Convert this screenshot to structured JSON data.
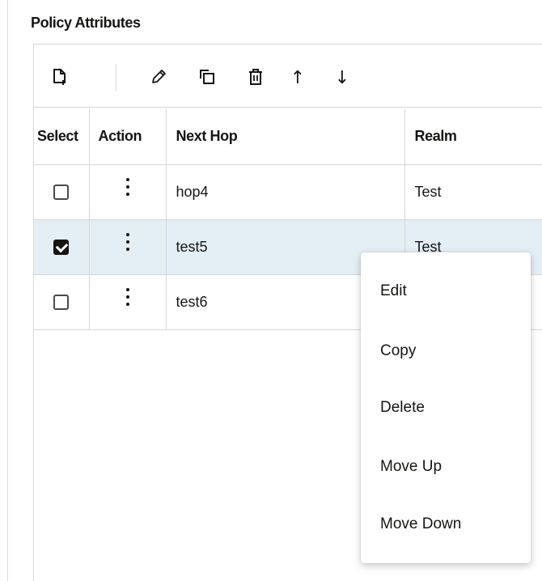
{
  "section": {
    "title": "Policy Attributes"
  },
  "toolbar": {
    "buttons": [
      {
        "icon": "new-document-icon"
      },
      {
        "icon": "pencil-icon"
      },
      {
        "icon": "copy-icon"
      },
      {
        "icon": "trash-icon"
      },
      {
        "icon": "arrow-up-icon",
        "glyph": "↑"
      },
      {
        "icon": "arrow-down-icon",
        "glyph": "↓"
      }
    ]
  },
  "table": {
    "columns": [
      "Select",
      "Action",
      "Next Hop",
      "Realm"
    ],
    "rows": [
      {
        "checked": false,
        "next_hop": "hop4",
        "realm": "Test"
      },
      {
        "checked": true,
        "next_hop": "test5",
        "realm": "Test"
      },
      {
        "checked": false,
        "next_hop": "test6",
        "realm": ""
      }
    ]
  },
  "context_menu": {
    "items": [
      "Edit",
      "Copy",
      "Delete",
      "Move Up",
      "Move Down"
    ]
  },
  "colors": {
    "selected_row": "#e4eef5",
    "border": "#d6d6d6",
    "text": "#161513"
  }
}
